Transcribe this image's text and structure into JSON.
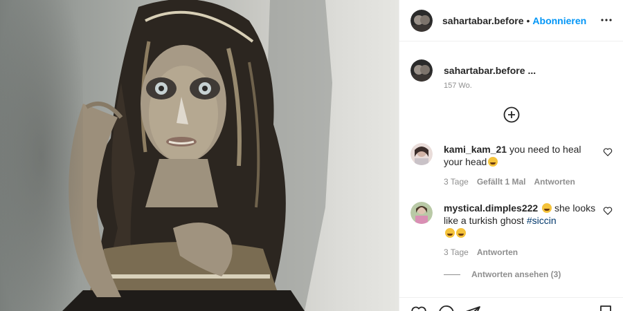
{
  "post": {
    "author": "sahartabar.before",
    "follow_label": "Abonnieren",
    "separator": "•",
    "caption_user": "sahartabar.before",
    "caption_more": "...",
    "age": "157 Wo."
  },
  "comments": [
    {
      "user": "kami_kam_21",
      "text": "you need to heal your head",
      "time": "3 Tage",
      "likes": "Gefällt 1 Mal",
      "reply": "Antworten"
    },
    {
      "user": "mystical.dimples222",
      "text": "she looks like a turkish ghost",
      "hashtag": "#siccin",
      "time": "3 Tage",
      "reply": "Antworten"
    }
  ],
  "view_replies": "Antworten ansehen (3)",
  "icons": {
    "more": "more-horizontal-icon",
    "load_more": "plus-circle-icon",
    "heart": "heart-outline-icon",
    "comment": "comment-icon",
    "share": "send-icon",
    "save": "bookmark-icon"
  },
  "colors": {
    "follow_blue": "#0095f6",
    "text": "#262626",
    "muted": "#8e8e8e",
    "hashtag": "#00376b"
  }
}
